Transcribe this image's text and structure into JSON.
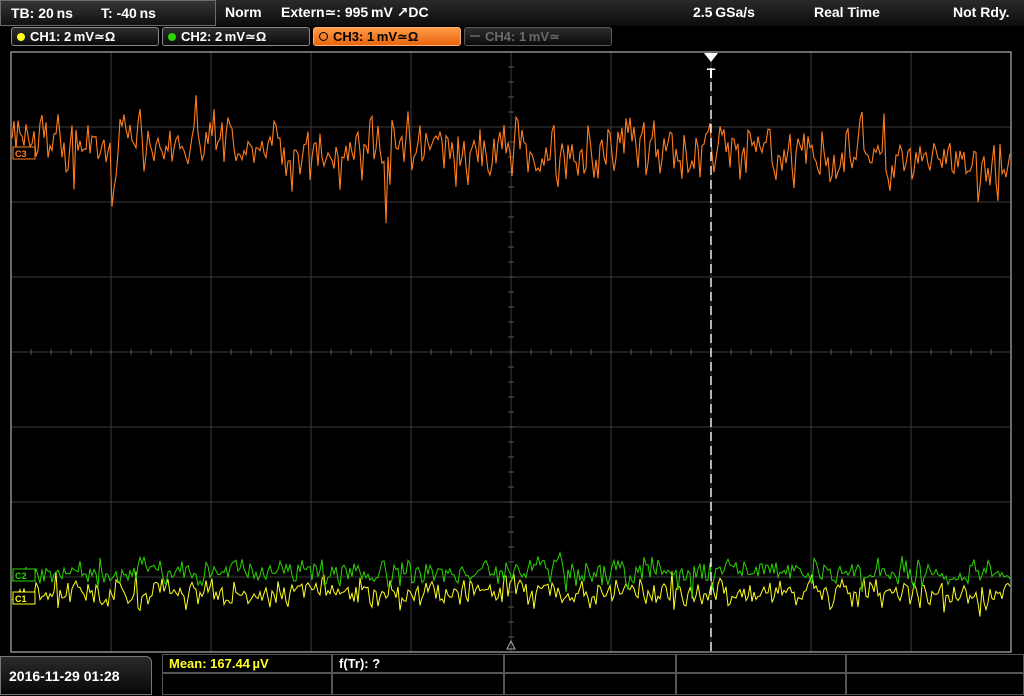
{
  "statusbar": {
    "timebase": "TB: 20 ns",
    "trigger_offset": "T: -40 ns",
    "trigger_mode": "Norm",
    "trigger_source": "Extern≃: 995 mV ↗DC",
    "sample_rate": "2.5 GSa/s",
    "acquisition_mode": "Real Time",
    "status": "Not Rdy."
  },
  "channels": [
    {
      "label": "CH1: 2 mV≃Ω",
      "color": "#ffff1e",
      "state": "on"
    },
    {
      "label": "CH2: 2 mV≃Ω",
      "color": "#2bd400",
      "state": "on"
    },
    {
      "label": "CH3: 1 mV≃Ω",
      "color": "#ff7e1e",
      "state": "selected"
    },
    {
      "label": "CH4: 1 mV≃",
      "color": "#555555",
      "state": "off"
    }
  ],
  "markers": {
    "trigger": "T",
    "ch1_ref": "C1",
    "ch2_ref": "C2",
    "ch3_ref": "C3"
  },
  "footer": {
    "datetime": "2016-11-29 01:28",
    "measurement_1": "Mean: 167.44 µV",
    "measurement_2": "f(Tr): ?"
  },
  "colors": {
    "grid": "#3c3c3c",
    "ch1": "#ffff1e",
    "ch2": "#2bd400",
    "ch3": "#ff7e1e",
    "trigger_line": "#ffffff",
    "measure_text": "#ffff28"
  }
}
